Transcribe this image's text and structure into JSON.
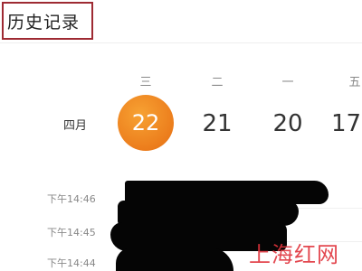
{
  "header": {
    "title": "历史记录"
  },
  "calendar": {
    "month_label": "四月",
    "weekdays": [
      "三",
      "二",
      "一",
      "五"
    ],
    "dates": [
      {
        "day": "22",
        "selected": true
      },
      {
        "day": "21",
        "selected": false
      },
      {
        "day": "20",
        "selected": false
      },
      {
        "day": "17",
        "selected": false
      }
    ]
  },
  "history": {
    "items": [
      {
        "time": "下午14:46"
      },
      {
        "time": "下午14:45"
      },
      {
        "time": "下午14:44"
      }
    ]
  },
  "watermark": {
    "text": "上海红网"
  },
  "colors": {
    "accent": "#ec7d1c",
    "title_border": "#9e2a33",
    "watermark": "#e0343c"
  }
}
